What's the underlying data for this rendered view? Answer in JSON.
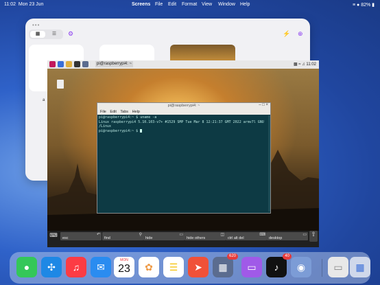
{
  "menubar": {
    "time": "11:02",
    "date": "Mon 23 Jun",
    "app": "Screens",
    "menus": [
      "File",
      "Edit",
      "Format",
      "View",
      "Window",
      "Help"
    ],
    "battery": "82%"
  },
  "screens_window": {
    "label": "a"
  },
  "rpi": {
    "taskbar_task": "pi@raspberrypi4: ~",
    "clock": "11:02",
    "terminal": {
      "title": "pi@raspberrypi4: ~",
      "menus": [
        "File",
        "Edit",
        "Tabs",
        "Help"
      ],
      "lines": [
        "pi@raspberrypi4:~ $ uname -a",
        "Linux raspberrypi4 5.10.103-v7+ #1529 SMP Tue Mar 8 12:21:37 GMT 2022 armv7l GNU",
        "/Linux",
        "pi@raspberrypi4:~ $ "
      ]
    },
    "keys": [
      "esc",
      "find",
      "hide",
      "hide others",
      "ctrl alt del",
      "desktop"
    ]
  },
  "dock": {
    "calendar_day": "MON",
    "calendar_date": "23",
    "badges": {
      "folder": "620",
      "tiktok": "40"
    }
  },
  "colors": {
    "terminal_bg": "#0d3a44",
    "accent": "#8b3df0"
  }
}
